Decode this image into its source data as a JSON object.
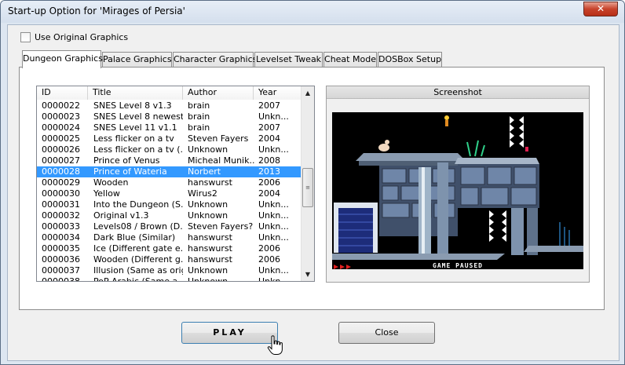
{
  "window": {
    "title": "Start-up Option for 'Mirages of Persia'",
    "close_glyph": "✕"
  },
  "options": {
    "use_original_graphics_label": "Use Original Graphics",
    "use_original_graphics_checked": false
  },
  "tabs": [
    {
      "label": "Dungeon Graphics",
      "active": true
    },
    {
      "label": "Palace Graphics",
      "active": false
    },
    {
      "label": "Character Graphics",
      "active": false
    },
    {
      "label": "Levelset Tweak",
      "active": false
    },
    {
      "label": "Cheat Mode",
      "active": false
    },
    {
      "label": "DOSBox Setup",
      "active": false
    }
  ],
  "list": {
    "columns": [
      "ID",
      "Title",
      "Author",
      "Year"
    ],
    "rows": [
      {
        "id": "0000022",
        "title": "SNES Level 8 v1.3",
        "author": "brain",
        "year": "2007"
      },
      {
        "id": "0000023",
        "title": "SNES Level 8 newest",
        "author": "brain",
        "year": "Unkn..."
      },
      {
        "id": "0000024",
        "title": "SNES Level 11 v1.1",
        "author": "brain",
        "year": "2007"
      },
      {
        "id": "0000025",
        "title": "Less flicker on a tv",
        "author": "Steven Fayers",
        "year": "2004"
      },
      {
        "id": "0000026",
        "title": "Less flicker on a tv (...",
        "author": "Unknown",
        "year": "Unkn..."
      },
      {
        "id": "0000027",
        "title": "Prince of Venus",
        "author": "Micheal Munik...",
        "year": "2008"
      },
      {
        "id": "0000028",
        "title": "Prince of Wateria",
        "author": "Norbert",
        "year": "2013",
        "selected": true
      },
      {
        "id": "0000029",
        "title": "Wooden",
        "author": "hanswurst",
        "year": "2006"
      },
      {
        "id": "0000030",
        "title": "Yellow",
        "author": "Wirus2",
        "year": "2004"
      },
      {
        "id": "0000031",
        "title": "Into the Dungeon (S...",
        "author": "Unknown",
        "year": "Unkn..."
      },
      {
        "id": "0000032",
        "title": "Original v1.3",
        "author": "Unknown",
        "year": "Unkn..."
      },
      {
        "id": "0000033",
        "title": "Levels08 / Brown (D...",
        "author": "Steven Fayers?",
        "year": "Unkn..."
      },
      {
        "id": "0000034",
        "title": "Dark Blue (Similar)",
        "author": "hanswurst",
        "year": "Unkn..."
      },
      {
        "id": "0000035",
        "title": "Ice (Different gate e...",
        "author": "hanswurst",
        "year": "2006"
      },
      {
        "id": "0000036",
        "title": "Wooden (Different g...",
        "author": "hanswurst",
        "year": "2006"
      },
      {
        "id": "0000037",
        "title": "Illusion (Same as orig...",
        "author": "Unknown",
        "year": "Unkn..."
      },
      {
        "id": "0000038",
        "title": "PoP Arabic (Same a...",
        "author": "Unknown",
        "year": "Unkn..."
      }
    ],
    "scroll_up_glyph": "▲",
    "scroll_down_glyph": "▼",
    "scroll_thumb_grip": "≡"
  },
  "screenshot": {
    "title": "Screenshot",
    "game_status": "GAME PAUSED"
  },
  "buttons": {
    "play": "PLAY",
    "close": "Close"
  },
  "colors": {
    "selection": "#3399ff",
    "window_frame": "#dde6f1",
    "close_red": "#c7432b"
  },
  "icons": {
    "close": "close-icon",
    "cursor": "hand-pointer-icon",
    "scroll_up": "chevron-up-icon",
    "scroll_down": "chevron-down-icon"
  }
}
